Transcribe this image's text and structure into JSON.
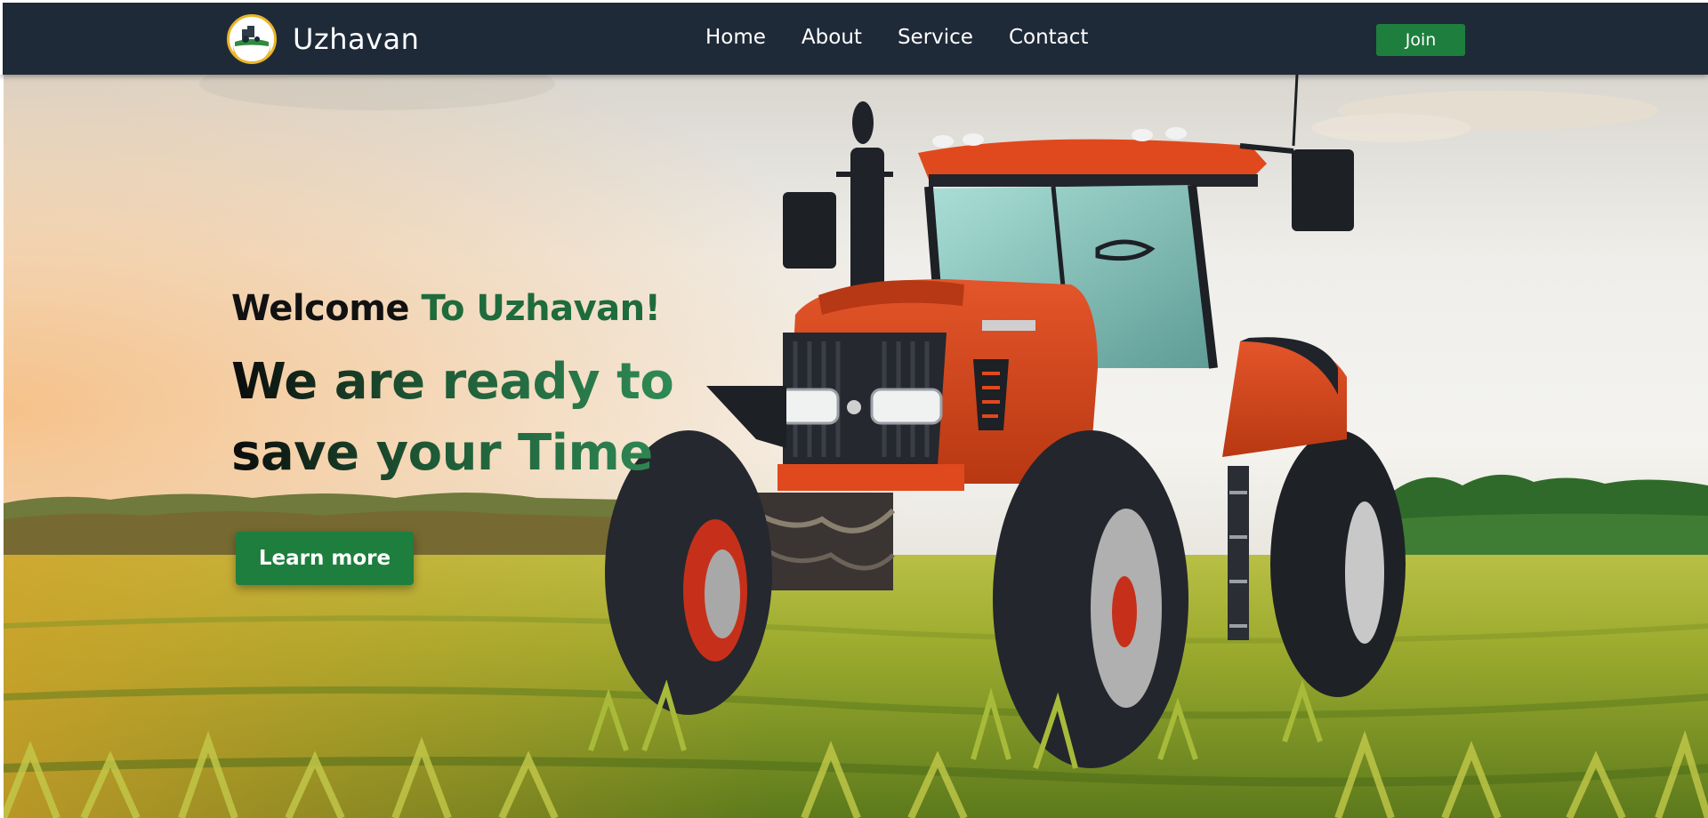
{
  "nav": {
    "brand": "Uzhavan",
    "logo_icon": "tractor-logo-icon",
    "links": [
      "Home",
      "About",
      "Service",
      "Contact"
    ],
    "join_label": "Join"
  },
  "hero": {
    "welcome_prefix": "Welcome",
    "welcome_accent": "To Uzhavan!",
    "tagline_line1": "We are ready to",
    "tagline_line2": "save your Time",
    "cta_label": "Learn more",
    "image_icon": "tractor-in-field-image"
  },
  "colors": {
    "navbar": "#1f2a38",
    "accent_green": "#1e7e3e",
    "heading_green": "#1e6b3c",
    "tractor_orange": "#d9461c"
  }
}
